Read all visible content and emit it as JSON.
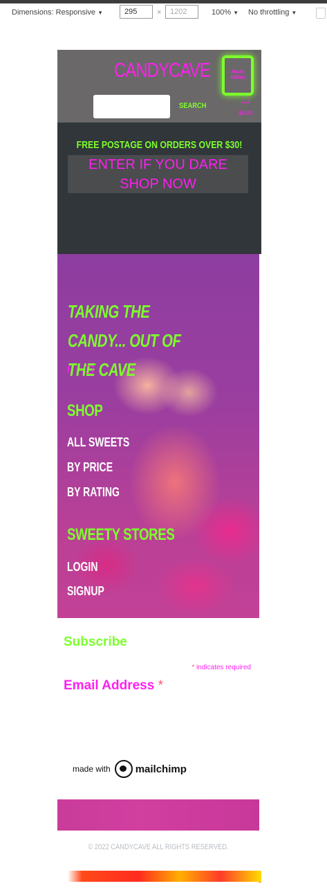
{
  "devtools": {
    "dimensions_label": "Dimensions: Responsive",
    "width_value": "295",
    "height_value": "1202",
    "times": "×",
    "zoom": "100%",
    "throttling": "No throttling"
  },
  "header": {
    "logo": "CANDYCAVE",
    "menu_button": "MAIN MENU",
    "search_button": "SEARCH",
    "cart_total": "$0.00"
  },
  "banner": {
    "free_postage": "FREE POSTAGE ON ORDERS OVER $30!",
    "shop_now": "ENTER IF YOU DARE SHOP NOW"
  },
  "footer": {
    "tagline": "TAKING THE CANDY... OUT OF THE CAVE",
    "social_icons": [
      "facebook-icon",
      "instagram-icon"
    ],
    "shop_title": "SHOP",
    "shop_links": [
      "ALL SWEETS",
      "BY PRICE",
      "BY RATING"
    ],
    "stores_title": "SWEETY STORES",
    "account_links": [
      "LOGIN",
      "SIGNUP"
    ]
  },
  "subscribe": {
    "title": "Subscribe",
    "required_star": "*",
    "required_note": "indicates required",
    "email_label": "Email Address",
    "made_with": "made with",
    "brand": "mailchimp"
  },
  "copyright": "© 2022 CANDYCAVE ALL RIGHTS RESERVED.",
  "colors": {
    "accent_pink": "#ff1ff0",
    "accent_green": "#7cff2c",
    "header_bg": "#6a6868",
    "banner_bg": "#31363a"
  }
}
